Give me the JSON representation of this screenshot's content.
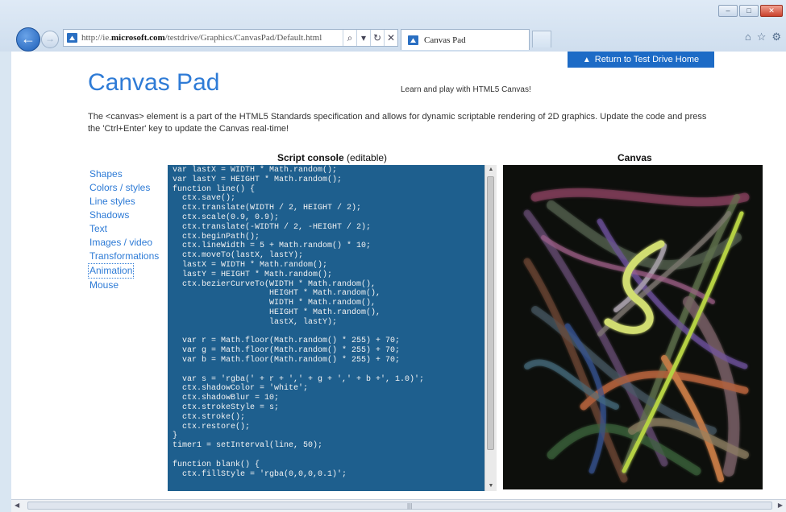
{
  "browser": {
    "url_prefix": "http://ie.",
    "url_domain": "microsoft.com",
    "url_path": "/testdrive/Graphics/CanvasPad/Default.html",
    "tab_title": "Canvas Pad",
    "search_icon": "⌕",
    "dropdown_icon": "▾",
    "refresh_icon": "↻",
    "stop_icon": "✕",
    "back_icon": "←",
    "forward_icon": "→",
    "home_icon": "⌂",
    "favorites_icon": "☆",
    "tools_icon": "⚙",
    "minimize_icon": "–",
    "maximize_icon": "□",
    "close_icon": "✕"
  },
  "header": {
    "return_label": "Return to Test Drive Home",
    "title": "Canvas Pad",
    "tagline": "Learn and play with HTML5 Canvas!",
    "description": "The <canvas> element is a part of the HTML5 Standards specification and allows for dynamic scriptable rendering of 2D graphics. Update the code and press the 'Ctrl+Enter' key to update the Canvas real-time!"
  },
  "columns": {
    "script_bold": "Script console",
    "script_note": " (editable)",
    "canvas": "Canvas"
  },
  "sidebar": {
    "items": [
      {
        "label": "Shapes"
      },
      {
        "label": "Colors / styles"
      },
      {
        "label": "Line styles"
      },
      {
        "label": "Shadows"
      },
      {
        "label": "Text"
      },
      {
        "label": "Images / video"
      },
      {
        "label": "Transformations"
      },
      {
        "label": "Animation"
      },
      {
        "label": "Mouse"
      }
    ],
    "active_index": 7
  },
  "console": {
    "code": "var lastX = WIDTH * Math.random();\nvar lastY = HEIGHT * Math.random();\nfunction line() {\n  ctx.save();\n  ctx.translate(WIDTH / 2, HEIGHT / 2);\n  ctx.scale(0.9, 0.9);\n  ctx.translate(-WIDTH / 2, -HEIGHT / 2);\n  ctx.beginPath();\n  ctx.lineWidth = 5 + Math.random() * 10;\n  ctx.moveTo(lastX, lastY);\n  lastX = WIDTH * Math.random();\n  lastY = HEIGHT * Math.random();\n  ctx.bezierCurveTo(WIDTH * Math.random(),\n                    HEIGHT * Math.random(),\n                    WIDTH * Math.random(),\n                    HEIGHT * Math.random(),\n                    lastX, lastY);\n\n  var r = Math.floor(Math.random() * 255) + 70;\n  var g = Math.floor(Math.random() * 255) + 70;\n  var b = Math.floor(Math.random() * 255) + 70;\n\n  var s = 'rgba(' + r + ',' + g + ',' + b +', 1.0)';\n  ctx.shadowColor = 'white';\n  ctx.shadowBlur = 10;\n  ctx.strokeStyle = s;\n  ctx.stroke();\n  ctx.restore();\n}\ntimer1 = setInterval(line, 50);\n\nfunction blank() {\n  ctx.fillStyle = 'rgba(0,0,0,0.1)';"
  },
  "colors": {
    "accent": "#2e7bd6",
    "console_bg": "#1e5f8e",
    "canvas_bg": "#0d0f0c",
    "return_bg": "#1d6bc6"
  }
}
